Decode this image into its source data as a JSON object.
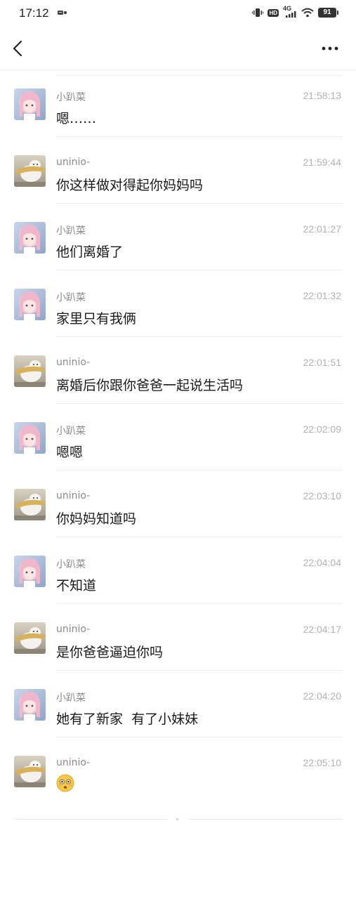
{
  "status_bar": {
    "time": "17:12",
    "network": "4G",
    "hd": "HD",
    "battery": "91"
  },
  "nav": {
    "back_icon": "chevron-left-icon",
    "more_icon": "more-dots-icon"
  },
  "messages": [
    {
      "sender": "小趴菜",
      "time": "21:58:13",
      "content": "嗯……",
      "avatar": "anime-girl-avatar"
    },
    {
      "sender": "uninio-",
      "time": "21:59:44",
      "content": "你这样做对得起你妈妈吗",
      "avatar": "white-dog-avatar"
    },
    {
      "sender": "小趴菜",
      "time": "22:01:27",
      "content": "他们离婚了",
      "avatar": "anime-girl-avatar"
    },
    {
      "sender": "小趴菜",
      "time": "22:01:32",
      "content": "家里只有我俩",
      "avatar": "anime-girl-avatar"
    },
    {
      "sender": "uninio-",
      "time": "22:01:51",
      "content": "离婚后你跟你爸爸一起说生活吗",
      "avatar": "white-dog-avatar"
    },
    {
      "sender": "小趴菜",
      "time": "22:02:09",
      "content": "嗯嗯",
      "avatar": "anime-girl-avatar"
    },
    {
      "sender": "uninio-",
      "time": "22:03:10",
      "content": "你妈妈知道吗",
      "avatar": "white-dog-avatar"
    },
    {
      "sender": "小趴菜",
      "time": "22:04:04",
      "content": "不知道",
      "avatar": "anime-girl-avatar"
    },
    {
      "sender": "uninio-",
      "time": "22:04:17",
      "content": "是你爸爸逼迫你吗",
      "avatar": "white-dog-avatar"
    },
    {
      "sender": "小趴菜",
      "time": "22:04:20",
      "content": "她有了新家  有了小妹妹",
      "avatar": "anime-girl-avatar"
    },
    {
      "sender": "uninio-",
      "time": "22:05:10",
      "content": "",
      "emoji": "flushed-face-emoji",
      "avatar": "white-dog-avatar"
    }
  ]
}
